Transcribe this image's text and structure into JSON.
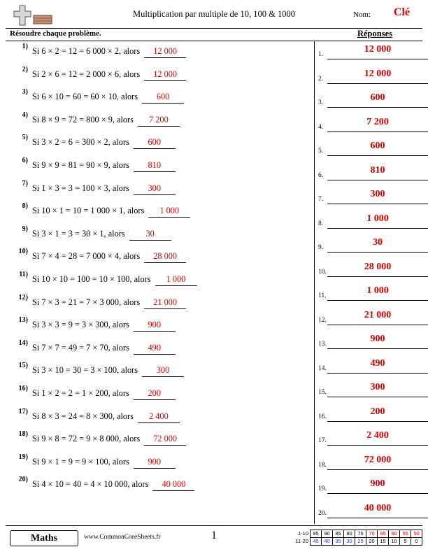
{
  "header": {
    "title": "Multiplication par multiple de 10, 100 & 1000",
    "nom_label": "Nom:",
    "nom_value": "Clé",
    "logo_icon": "cross-and-book-icon"
  },
  "subheader": {
    "instruction": "Résoudre chaque problème.",
    "answers_title": "Réponses"
  },
  "problems": [
    {
      "num": "1)",
      "text": "Si 6 × 2 = 12 = 6 000 × 2, alors",
      "answer": "12 000"
    },
    {
      "num": "2)",
      "text": "Si 2 × 6 = 12 = 2 000 × 6, alors",
      "answer": "12 000"
    },
    {
      "num": "3)",
      "text": "Si 6 × 10 = 60 = 60 × 10, alors",
      "answer": "600"
    },
    {
      "num": "4)",
      "text": "Si 8 × 9 = 72 = 800 × 9, alors",
      "answer": "7 200"
    },
    {
      "num": "5)",
      "text": "Si 3 × 2 = 6 = 300 × 2, alors",
      "answer": "600"
    },
    {
      "num": "6)",
      "text": "Si 9 × 9 = 81 = 90 × 9, alors",
      "answer": "810"
    },
    {
      "num": "7)",
      "text": "Si 1 × 3 = 3 = 100 × 3, alors",
      "answer": "300"
    },
    {
      "num": "8)",
      "text": "Si 10 × 1 = 10 = 1 000 × 1, alors",
      "answer": "1 000"
    },
    {
      "num": "9)",
      "text": "Si 3 × 1 = 3 = 30 × 1, alors",
      "answer": "30"
    },
    {
      "num": "10)",
      "text": "Si 7 × 4 = 28 = 7 000 × 4, alors",
      "answer": "28 000"
    },
    {
      "num": "11)",
      "text": "Si 10 × 10 = 100 = 10 × 100, alors",
      "answer": "1 000"
    },
    {
      "num": "12)",
      "text": "Si 7 × 3 = 21 = 7 × 3 000, alors",
      "answer": "21 000"
    },
    {
      "num": "13)",
      "text": "Si 3 × 3 = 9 = 3 × 300, alors",
      "answer": "900"
    },
    {
      "num": "14)",
      "text": "Si 7 × 7 = 49 = 7 × 70, alors",
      "answer": "490"
    },
    {
      "num": "15)",
      "text": "Si 3 × 10 = 30 = 3 × 100, alors",
      "answer": "300"
    },
    {
      "num": "16)",
      "text": "Si 1 × 2 = 2 = 1 × 200, alors",
      "answer": "200"
    },
    {
      "num": "17)",
      "text": "Si 8 × 3 = 24 = 8 × 300, alors",
      "answer": "2 400"
    },
    {
      "num": "18)",
      "text": "Si 9 × 8 = 72 = 9 × 8 000, alors",
      "answer": "72 000"
    },
    {
      "num": "19)",
      "text": "Si 9 × 1 = 9 = 9 × 100, alors",
      "answer": "900"
    },
    {
      "num": "20)",
      "text": "Si 4 × 10 = 40 = 4 × 10 000, alors",
      "answer": "40 000"
    }
  ],
  "answers": [
    {
      "num": "1.",
      "value": "12 000"
    },
    {
      "num": "2.",
      "value": "12 000"
    },
    {
      "num": "3.",
      "value": "600"
    },
    {
      "num": "4.",
      "value": "7 200"
    },
    {
      "num": "5.",
      "value": "600"
    },
    {
      "num": "6.",
      "value": "810"
    },
    {
      "num": "7.",
      "value": "300"
    },
    {
      "num": "8.",
      "value": "1 000"
    },
    {
      "num": "9.",
      "value": "30"
    },
    {
      "num": "10.",
      "value": "28 000"
    },
    {
      "num": "11.",
      "value": "1 000"
    },
    {
      "num": "12.",
      "value": "21 000"
    },
    {
      "num": "13.",
      "value": "900"
    },
    {
      "num": "14.",
      "value": "490"
    },
    {
      "num": "15.",
      "value": "300"
    },
    {
      "num": "16.",
      "value": "200"
    },
    {
      "num": "17.",
      "value": "2 400"
    },
    {
      "num": "18.",
      "value": "72 000"
    },
    {
      "num": "19.",
      "value": "900"
    },
    {
      "num": "20.",
      "value": "40 000"
    }
  ],
  "footer": {
    "maths_label": "Maths",
    "site": "www.CommonCoreSheets.fr",
    "page_number": "1",
    "score_table": {
      "row1_label": "1-10",
      "row2_label": "11-20",
      "row1": [
        "95",
        "90",
        "85",
        "80",
        "75",
        "70",
        "65",
        "60",
        "55",
        "50"
      ],
      "row2": [
        "45",
        "40",
        "35",
        "30",
        "25",
        "20",
        "15",
        "10",
        "5",
        "0"
      ],
      "red_start_index": 5,
      "accent_red": "#e00000",
      "accent_blue": "#1a3fd0"
    }
  }
}
